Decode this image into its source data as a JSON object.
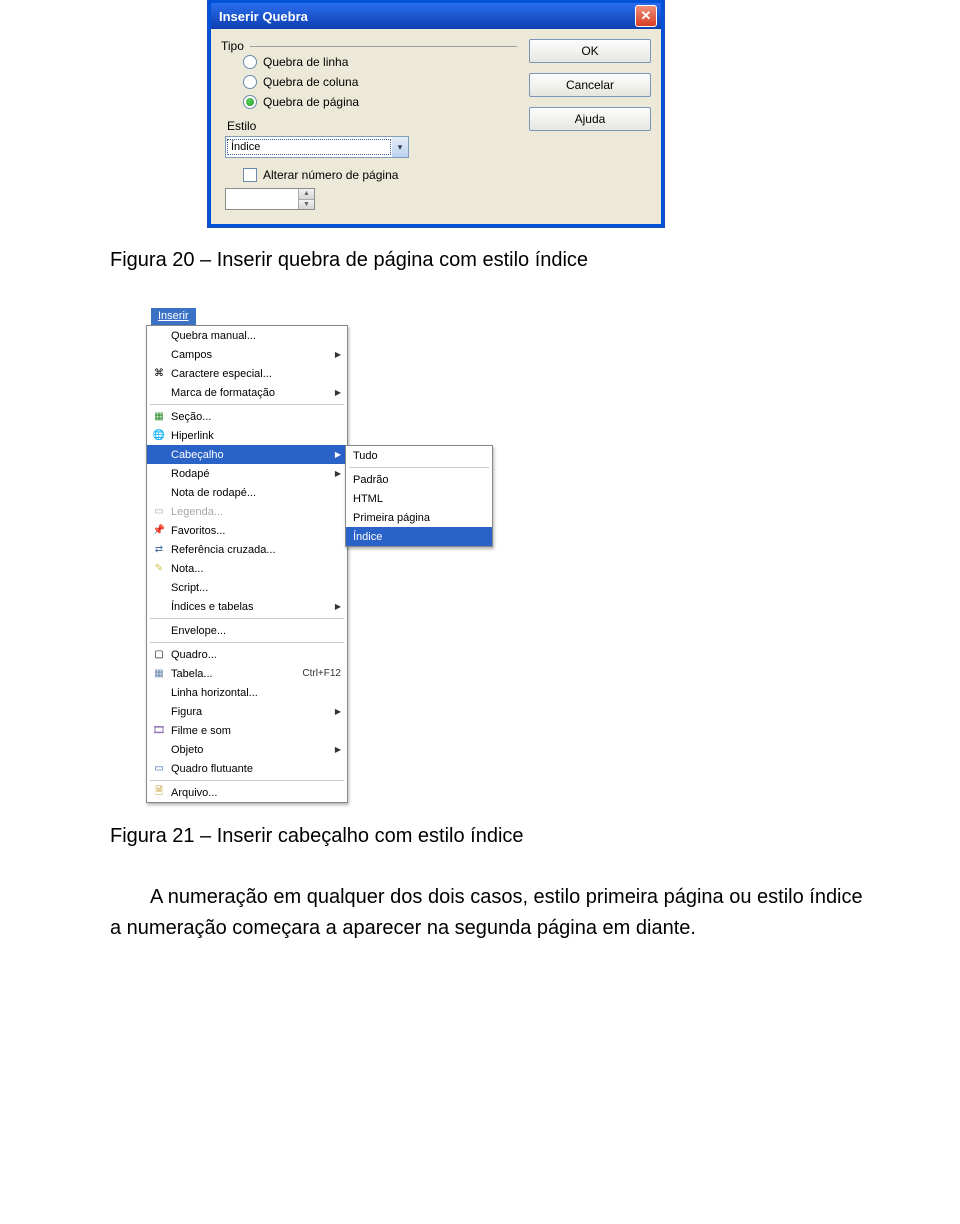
{
  "dialog": {
    "title": "Inserir Quebra",
    "group_label": "Tipo",
    "radios": {
      "line": "Quebra de linha",
      "column": "Quebra de coluna",
      "page": "Quebra de página"
    },
    "style_label": "Estilo",
    "style_value": "Índice",
    "change_num_label": "Alterar número de página",
    "buttons": {
      "ok": "OK",
      "cancel": "Cancelar",
      "help": "Ajuda"
    }
  },
  "captions": {
    "fig20": "Figura 20 – Inserir quebra de página com estilo índice",
    "fig21": "Figura 21 – Inserir cabeçalho com estilo índice"
  },
  "menu": {
    "top": "Inserir",
    "items": {
      "quebra": "Quebra manual...",
      "campos": "Campos",
      "caractere": "Caractere especial...",
      "marca": "Marca de formatação",
      "secao": "Seção...",
      "hiperlink": "Hiperlink",
      "cabecalho": "Cabeçalho",
      "rodape": "Rodapé",
      "notarodape": "Nota de rodapé...",
      "legenda": "Legenda...",
      "favoritos": "Favoritos...",
      "referencia": "Referência cruzada...",
      "nota": "Nota...",
      "script": "Script...",
      "indices": "Índices e tabelas",
      "envelope": "Envelope...",
      "quadro": "Quadro...",
      "tabela": "Tabela...",
      "tabela_sc": "Ctrl+F12",
      "linha": "Linha horizontal...",
      "figura": "Figura",
      "filme": "Filme e som",
      "objeto": "Objeto",
      "quadroflut": "Quadro flutuante",
      "arquivo": "Arquivo..."
    },
    "submenu": {
      "tudo": "Tudo",
      "padrao": "Padrão",
      "html": "HTML",
      "primeira": "Primeira página",
      "indice": "Índice"
    }
  },
  "paragraph": "A numeração em qualquer dos dois casos, estilo primeira página ou estilo índice a numeração começara a aparecer na segunda página em diante."
}
